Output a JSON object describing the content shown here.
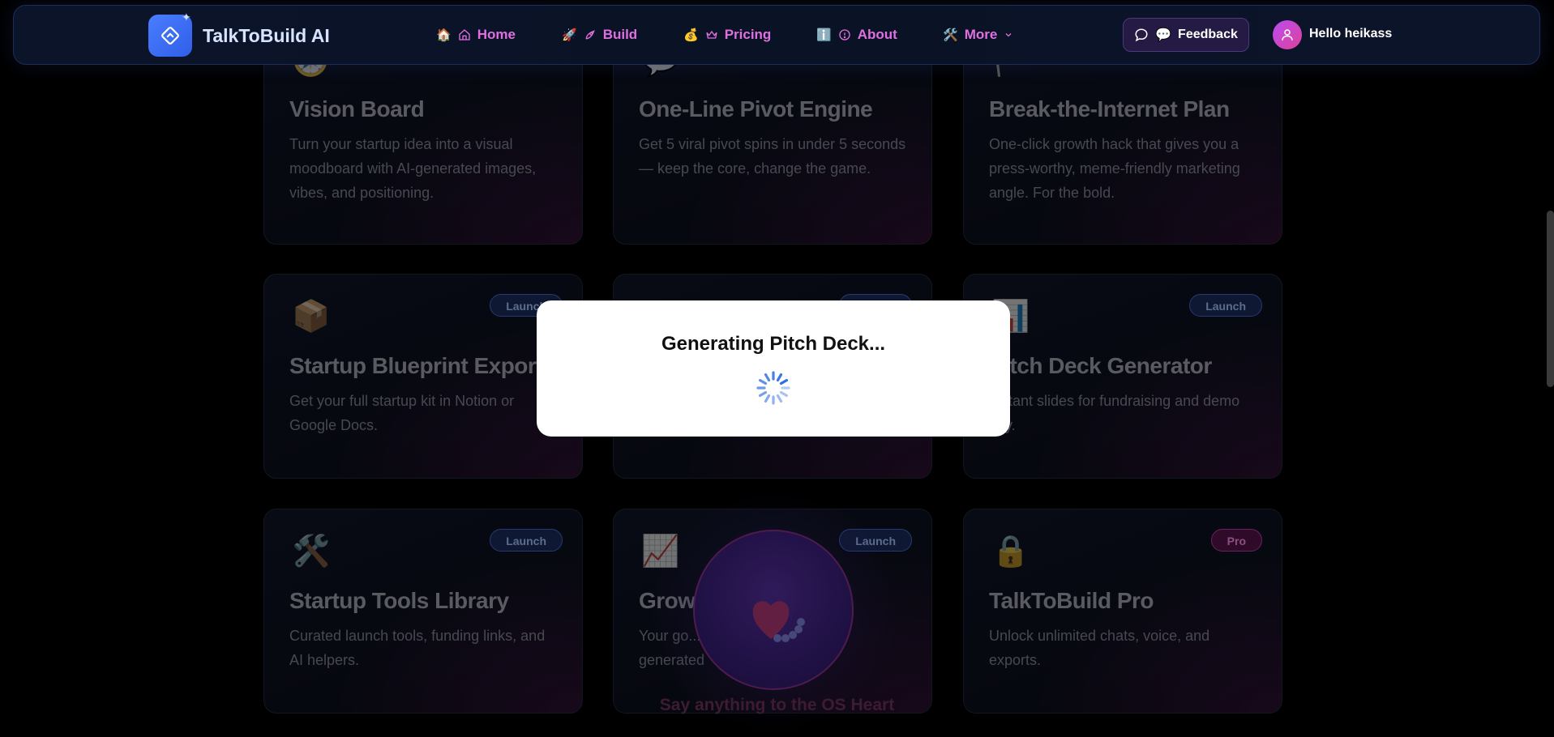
{
  "nav": {
    "brand": "TalkToBuild AI",
    "links": [
      {
        "emoji": "🏠",
        "label": "Home"
      },
      {
        "emoji": "🚀",
        "label": "Build"
      },
      {
        "emoji": "💰",
        "label": "Pricing"
      },
      {
        "emoji": "ℹ️",
        "label": "About"
      },
      {
        "emoji": "🛠️",
        "label": "More"
      }
    ],
    "feedback": {
      "emoji": "💬",
      "label": "Feedback"
    },
    "greeting": "Hello heikass"
  },
  "cards": [
    {
      "title": "Vision Board",
      "desc": "Turn your startup idea into a visual moodboard with AI-generated images, vibes, and positioning.",
      "icon": "🧭"
    },
    {
      "title": "One-Line Pivot Engine",
      "desc": "Get 5 viral pivot spins in under 5 seconds — keep the core, change the game.",
      "icon": "💬"
    },
    {
      "title": "Break-the-Internet Plan",
      "desc": "One-click growth hack that gives you a press-worthy, meme-friendly marketing angle. For the bold.",
      "icon": "🚩"
    },
    {
      "title": "Startup Blueprint Export",
      "desc": "Get your full startup kit in Notion or Google Docs.",
      "icon": "📦",
      "badge": "Launch"
    },
    {
      "title": "",
      "desc": "",
      "icon": "",
      "badge": "Launch"
    },
    {
      "title": "Pitch Deck Generator",
      "desc": "Instant slides for fundraising and demo day.",
      "icon": "📊",
      "badge": "Launch"
    },
    {
      "title": "Startup Tools Library",
      "desc": "Curated launch tools, funding links, and AI helpers.",
      "icon": "🛠️",
      "badge": "Launch"
    },
    {
      "title": "Grow",
      "desc": "Your go... generated",
      "icon": "📈",
      "badge": "Launch"
    },
    {
      "title": "TalkToBuild Pro",
      "desc": "Unlock unlimited chats, voice, and exports.",
      "icon": "🔒",
      "badge": "Pro"
    }
  ],
  "modal": {
    "title": "Generating Pitch Deck..."
  },
  "voice": {
    "caption": "Say anything to the OS Heart"
  }
}
